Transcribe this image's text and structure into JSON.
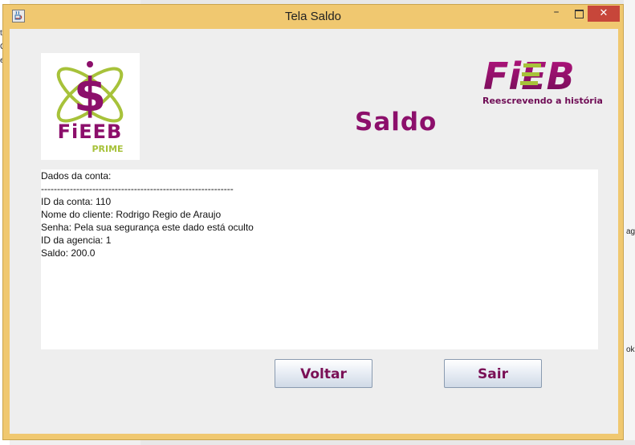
{
  "window": {
    "title": "Tela Saldo",
    "minimize_glyph": "–",
    "close_glyph": "✕"
  },
  "background": {
    "left_fragments": [
      "tr",
      "Ge",
      "ec"
    ],
    "right_fragments": [
      "ag",
      "ok"
    ]
  },
  "header": {
    "title": "Saldo",
    "logo_left": {
      "brand": "FiEEB",
      "sub": "PRIME",
      "icon": "dollar-atom-logo"
    },
    "logo_right": {
      "brand": "FiEB",
      "tagline": "Reescrevendo a história"
    }
  },
  "account_info": {
    "heading": "Dados da conta:",
    "separator": "------------------------------------------------------------",
    "id_conta": "ID da conta: 110",
    "nome_cliente": "Nome do cliente: Rodrigo Regio de Araujo",
    "senha": "Senha: Pela sua segurança este dado está oculto",
    "id_agencia": "ID da agencia: 1",
    "saldo": "Saldo: 200.0"
  },
  "buttons": {
    "voltar": "Voltar",
    "sair": "Sair"
  },
  "colors": {
    "accent": "#8c0f6b",
    "logo_green": "#a7c23a",
    "window_frame": "#f0c870",
    "close_button": "#c7463a"
  }
}
